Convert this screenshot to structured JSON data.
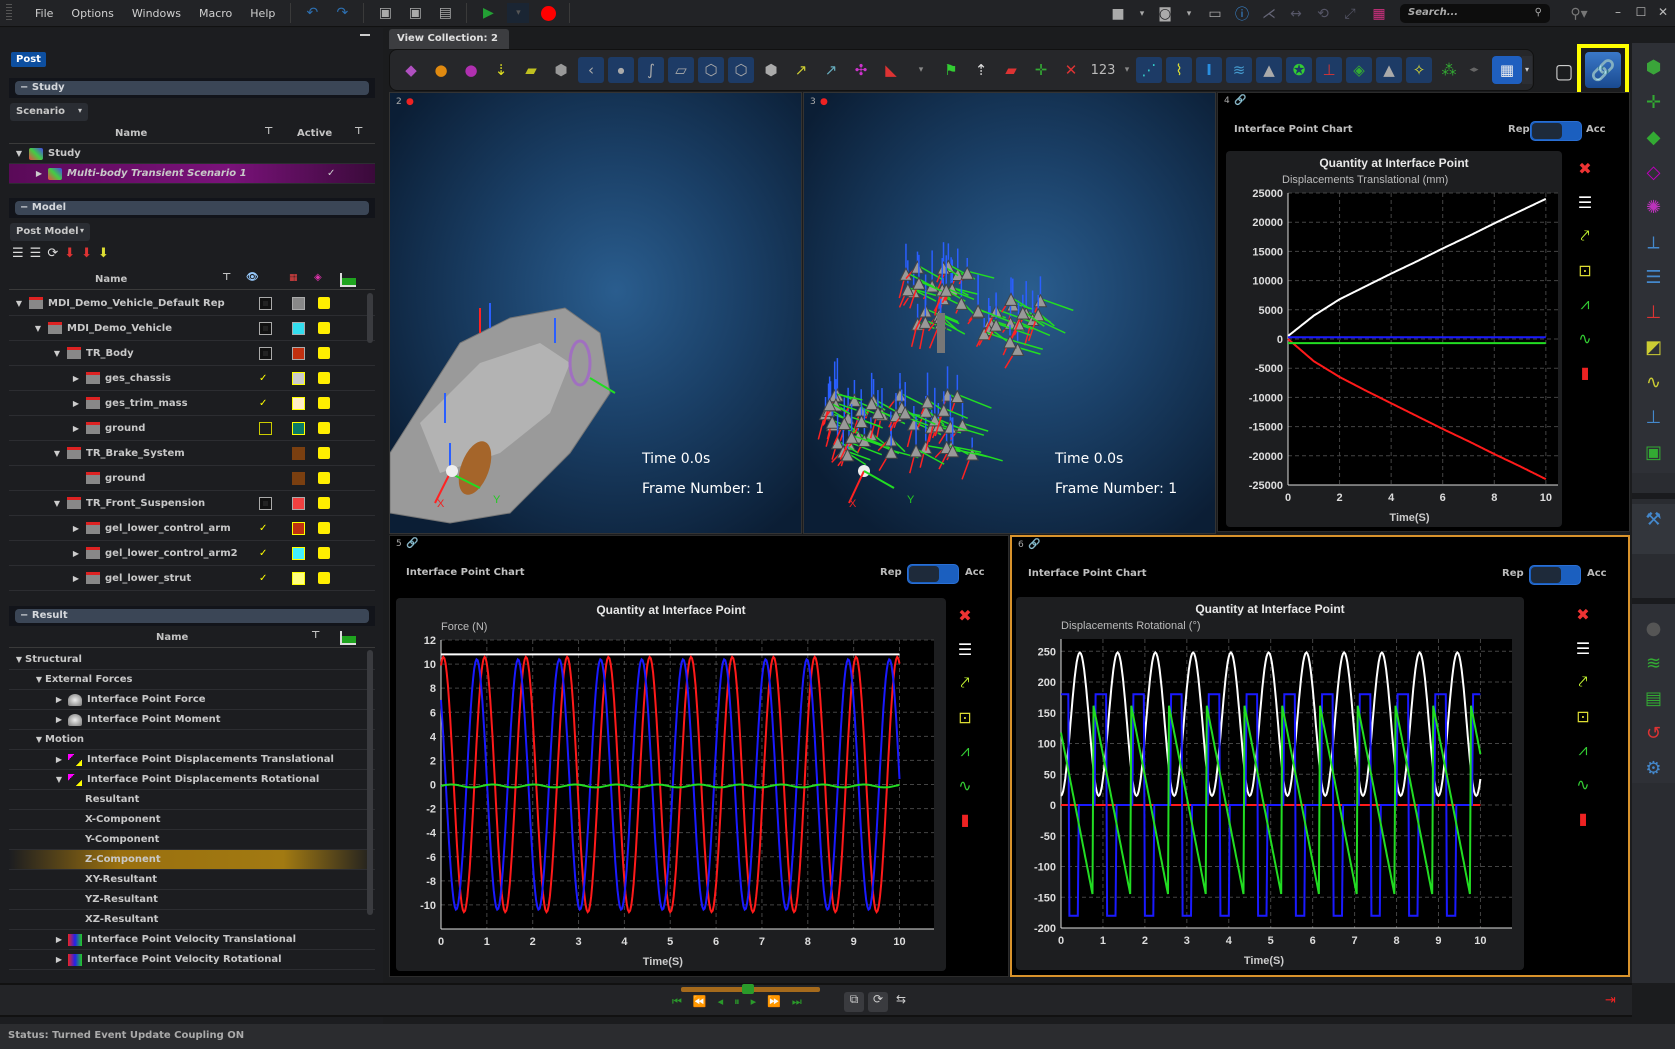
{
  "menu": {
    "items": [
      "File",
      "Options",
      "Windows",
      "Macro",
      "Help"
    ],
    "search_placeholder": "Search..."
  },
  "left_panel": {
    "tab": "Post",
    "study": {
      "section_label": "Study",
      "dropdown": "Scenario",
      "columns": [
        "Name",
        "Active"
      ],
      "rows": [
        {
          "label": "Study",
          "level": 0,
          "expanded": true,
          "active": ""
        },
        {
          "label": "Multi-body Transient Scenario 1",
          "level": 1,
          "expanded": false,
          "active": "✓",
          "selected": true
        }
      ]
    },
    "model": {
      "section_label": "Model",
      "dropdown": "Post Model",
      "columns": [
        "Name"
      ],
      "rows": [
        {
          "label": "MDI_Demo_Vehicle_Default Rep",
          "level": 0,
          "expanded": true,
          "color": "#888888",
          "chart": true
        },
        {
          "label": "MDI_Demo_Vehicle",
          "level": 1,
          "expanded": true,
          "color": "#33ddee",
          "chart": true
        },
        {
          "label": "TR_Body",
          "level": 2,
          "expanded": true,
          "color": "#c03010",
          "chart": false
        },
        {
          "label": "ges_chassis",
          "level": 3,
          "expanded": false,
          "color": "#cccccc",
          "check": true
        },
        {
          "label": "ges_trim_mass",
          "level": 3,
          "expanded": false,
          "color": "#ffeec8",
          "check": true
        },
        {
          "label": "ground",
          "level": 3,
          "expanded": false,
          "color": "#0a7a66",
          "check": false
        },
        {
          "label": "TR_Brake_System",
          "level": 2,
          "expanded": true,
          "color": "#7a3f10",
          "chart": false
        },
        {
          "label": "ground",
          "level": 3,
          "expanded": null,
          "color": "#7a3f10"
        },
        {
          "label": "TR_Front_Suspension",
          "level": 2,
          "expanded": true,
          "color": "#f04040",
          "chart": true
        },
        {
          "label": "gel_lower_control_arm",
          "level": 3,
          "expanded": false,
          "color": "#c03010",
          "check": true
        },
        {
          "label": "gel_lower_control_arm2",
          "level": 3,
          "expanded": false,
          "color": "#44f0ff",
          "check": true
        },
        {
          "label": "gel_lower_strut",
          "level": 3,
          "expanded": false,
          "color": "#ffff80",
          "check": true
        }
      ]
    },
    "result": {
      "section_label": "Result",
      "columns": [
        "Name"
      ],
      "rows": [
        {
          "label": "Structural",
          "level": 0,
          "expanded": true,
          "chart": false
        },
        {
          "label": "External Forces",
          "level": 1,
          "expanded": true,
          "chart": false
        },
        {
          "label": "Interface Point Force",
          "level": 2,
          "expanded": false,
          "chart": true,
          "icon": "force"
        },
        {
          "label": "Interface Point Moment",
          "level": 2,
          "expanded": false,
          "chart": true,
          "icon": "force"
        },
        {
          "label": "Motion",
          "level": 1,
          "expanded": true,
          "chart": false
        },
        {
          "label": "Interface Point Displacements Translational",
          "level": 2,
          "expanded": false,
          "chart": true,
          "icon": "disp"
        },
        {
          "label": "Interface Point Displacements Rotational",
          "level": 2,
          "expanded": true,
          "chart": true,
          "icon": "disp"
        },
        {
          "label": "Resultant",
          "level": 3,
          "chart": true
        },
        {
          "label": "X-Component",
          "level": 3,
          "chart": true
        },
        {
          "label": "Y-Component",
          "level": 3,
          "chart": true
        },
        {
          "label": "Z-Component",
          "level": 3,
          "chart": true,
          "selected": true
        },
        {
          "label": "XY-Resultant",
          "level": 3,
          "chart": true
        },
        {
          "label": "YZ-Resultant",
          "level": 3,
          "chart": true
        },
        {
          "label": "XZ-Resultant",
          "level": 3,
          "chart": true
        },
        {
          "label": "Interface Point Velocity Translational",
          "level": 2,
          "expanded": false,
          "chart": true,
          "icon": "vel"
        },
        {
          "label": "Interface Point Velocity Rotational",
          "level": 2,
          "expanded": false,
          "chart": true,
          "icon": "vel"
        }
      ]
    }
  },
  "view": {
    "tab_label": "View Collection: 2",
    "toolbar_counter": "123",
    "link_button_highlighted": true,
    "viewports": [
      {
        "id": "2",
        "time": "Time  0.0s",
        "frame": "Frame  Number:  1",
        "axis_x": "X",
        "axis_y": "Y"
      },
      {
        "id": "3",
        "time": "Time  0.0s",
        "frame": "Frame  Number:  1",
        "axis_x": "X",
        "axis_y": "Y"
      }
    ],
    "chart_panels": [
      {
        "id": "4",
        "title": "Interface Point Chart",
        "toggle_left": "Rep",
        "toggle_right": "Acc"
      },
      {
        "id": "5",
        "title": "Interface Point Chart",
        "toggle_left": "Rep",
        "toggle_right": "Acc"
      },
      {
        "id": "6",
        "title": "Interface Point Chart",
        "toggle_left": "Rep",
        "toggle_right": "Acc",
        "active": true
      }
    ]
  },
  "chart_data": [
    {
      "type": "line",
      "title": "Quantity at Interface Point",
      "ylabel": "Displacements Translational (mm)",
      "xlabel": "Time(S)",
      "xlim": [
        0,
        10
      ],
      "ylim": [
        -25000,
        25000
      ],
      "xticks": [
        0,
        2,
        4,
        6,
        8,
        10
      ],
      "yticks": [
        25000,
        20000,
        15000,
        10000,
        5000,
        0,
        -5000,
        -10000,
        -15000,
        -20000,
        -25000
      ],
      "grid": true,
      "series": [
        {
          "name": "Resultant",
          "color": "#ffffff",
          "x": [
            0,
            1,
            2,
            3,
            4,
            5,
            6,
            7,
            8,
            9,
            10
          ],
          "y": [
            500,
            4000,
            6800,
            9000,
            11200,
            13300,
            15500,
            17600,
            19800,
            21900,
            24000
          ]
        },
        {
          "name": "X",
          "color": "#ff1a1a",
          "x": [
            0,
            1,
            2,
            3,
            4,
            5,
            6,
            7,
            8,
            9,
            10
          ],
          "y": [
            0,
            -3800,
            -6500,
            -8800,
            -11000,
            -13200,
            -15400,
            -17500,
            -19700,
            -21800,
            -24000
          ]
        },
        {
          "name": "Y",
          "color": "#1a1aff",
          "x": [
            0,
            10
          ],
          "y": [
            300,
            300
          ]
        },
        {
          "name": "Z",
          "color": "#22dd22",
          "x": [
            0,
            10
          ],
          "y": [
            -700,
            -700
          ]
        }
      ]
    },
    {
      "type": "line",
      "title": "Quantity at Interface Point",
      "ylabel": "Force (N)",
      "xlabel": "Time(S)",
      "xlim": [
        0,
        10
      ],
      "ylim": [
        -12,
        12
      ],
      "xticks": [
        0,
        1,
        2,
        3,
        4,
        5,
        6,
        7,
        8,
        9,
        10
      ],
      "yticks": [
        12,
        10,
        8,
        6,
        4,
        2,
        0,
        -2,
        -4,
        -6,
        -8,
        -10
      ],
      "grid": true,
      "series": [
        {
          "name": "Resultant",
          "color": "#ffffff",
          "kind": "const",
          "value": 10.8
        },
        {
          "name": "X",
          "color": "#ff1a1a",
          "kind": "sine",
          "amp": 10.6,
          "period": 0.9,
          "phase": 1.2
        },
        {
          "name": "Y",
          "color": "#1a1aff",
          "kind": "sine",
          "amp": 10.4,
          "period": 0.9,
          "phase": 2.4
        },
        {
          "name": "Z",
          "color": "#22dd22",
          "kind": "sine",
          "amp": 0.12,
          "offset": -0.12,
          "period": 0.9,
          "phase": 0
        }
      ]
    },
    {
      "type": "line",
      "title": "Quantity at Interface Point",
      "ylabel": "Displacements Rotational (°)",
      "xlabel": "Time(S)",
      "xlim": [
        0,
        10
      ],
      "ylim": [
        -200,
        270
      ],
      "xticks": [
        0,
        1,
        2,
        3,
        4,
        5,
        6,
        7,
        8,
        9,
        10
      ],
      "yticks": [
        250,
        200,
        150,
        100,
        50,
        0,
        -50,
        -100,
        -150,
        -200
      ],
      "grid": true,
      "series": [
        {
          "name": "Resultant",
          "color": "#ffffff",
          "kind": "peaks",
          "min": 15,
          "max": 248,
          "period": 0.9
        },
        {
          "name": "X",
          "color": "#ff1a1a",
          "kind": "const",
          "value": 0
        },
        {
          "name": "Y",
          "color": "#1a1aff",
          "kind": "square",
          "low": -180,
          "high": 180,
          "period": 0.9
        },
        {
          "name": "Z",
          "color": "#22dd22",
          "kind": "saw",
          "low": -150,
          "high": 165,
          "period": 0.9
        }
      ]
    }
  ],
  "playback": {
    "slider_position": 0.48
  },
  "status": {
    "label": "Status:",
    "text": "Turned Event Update Coupling ON"
  }
}
